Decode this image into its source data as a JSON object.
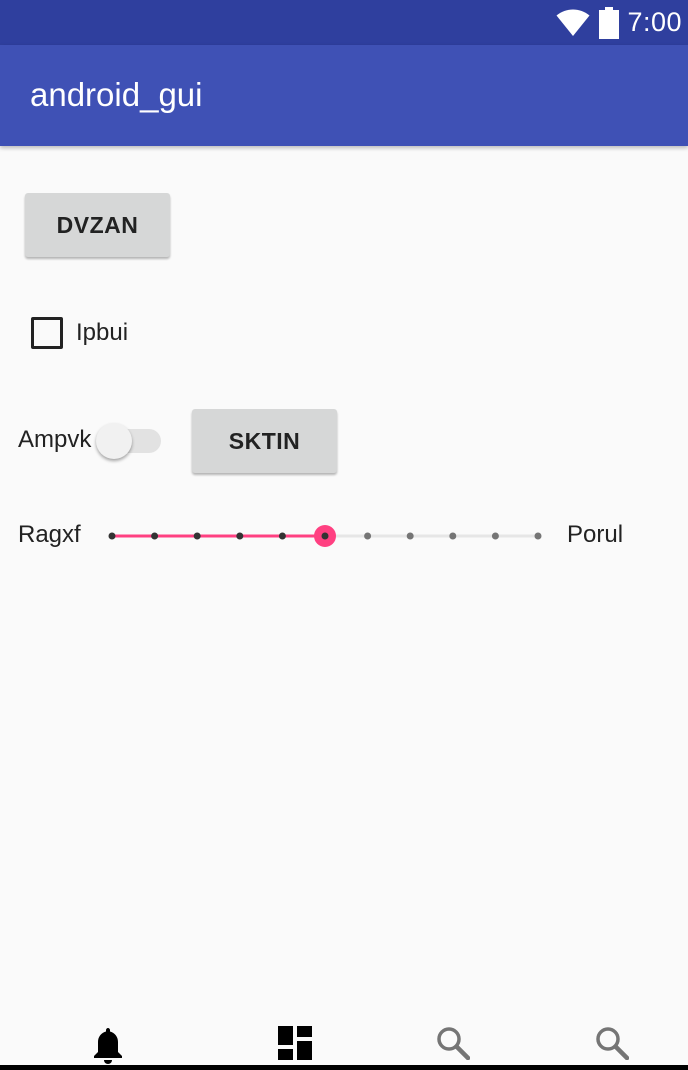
{
  "status_bar": {
    "time": "7:00",
    "icons": [
      "wifi-icon",
      "battery-icon"
    ]
  },
  "app_bar": {
    "title": "android_gui"
  },
  "main": {
    "button_1_label": "DVZAN",
    "checkbox": {
      "label": "Ipbui",
      "checked": false
    },
    "switch": {
      "label": "Ampvk",
      "on": false
    },
    "button_2_label": "SKTIN",
    "seekbar": {
      "min_label": "Ragxf",
      "max_label": "Porul",
      "steps": 10,
      "value": 5,
      "accent_color": "#FF4081",
      "tick_color": "#757575"
    }
  },
  "bottom_nav": {
    "items": [
      {
        "icon": "bell-icon",
        "selected": true
      },
      {
        "icon": "dashboard-icon",
        "selected": false
      },
      {
        "icon": "search-icon",
        "selected": false
      },
      {
        "icon": "search-icon",
        "selected": false
      }
    ]
  },
  "colors": {
    "status_bar": "#2F3F9E",
    "app_bar": "#3F51B5",
    "background": "#FAFAFA",
    "button": "#D6D7D7"
  }
}
